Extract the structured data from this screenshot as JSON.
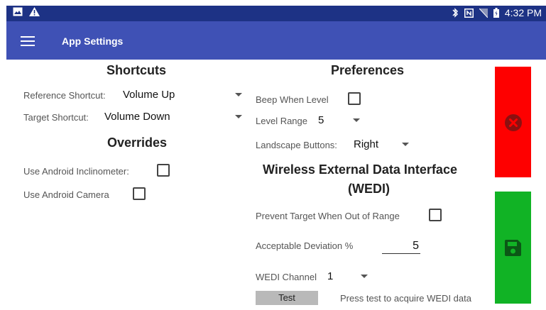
{
  "status_bar": {
    "time": "4:32 PM",
    "left_icons": [
      "image-icon",
      "warning-icon"
    ],
    "right_icons": [
      "bluetooth-icon",
      "nfc-icon",
      "no-sim-icon",
      "battery-icon"
    ]
  },
  "app_bar": {
    "title": "App Settings",
    "menu_icon": "hamburger-menu-icon"
  },
  "shortcuts": {
    "heading": "Shortcuts",
    "reference_label": "Reference Shortcut:",
    "reference_value": "Volume Up",
    "target_label": "Target Shortcut:",
    "target_value": "Volume Down"
  },
  "overrides": {
    "heading": "Overrides",
    "inclinometer_label": "Use Android Inclinometer:",
    "inclinometer_checked": false,
    "camera_label": "Use Android Camera",
    "camera_checked": false
  },
  "preferences": {
    "heading": "Preferences",
    "beep_label": "Beep When Level",
    "beep_checked": false,
    "level_range_label": "Level Range",
    "level_range_value": "5",
    "landscape_label": "Landscape Buttons:",
    "landscape_value": "Right"
  },
  "wedi": {
    "heading_line1": "Wireless External Data Interface",
    "heading_line2": "(WEDI)",
    "prevent_label": "Prevent Target When Out of Range",
    "prevent_checked": false,
    "deviation_label": "Acceptable Deviation %",
    "deviation_value": "5",
    "channel_label": "WEDI Channel",
    "channel_value": "1",
    "test_label": "Test",
    "test_hint": "Press test to acquire WEDI data"
  },
  "actions": {
    "cancel_icon": "cancel-circle-icon",
    "save_icon": "floppy-disk-icon",
    "cancel_color": "#fe0000",
    "save_color": "#11b325"
  }
}
